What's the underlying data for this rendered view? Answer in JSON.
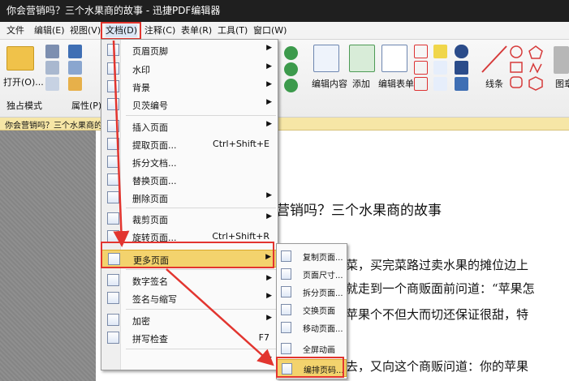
{
  "window": {
    "title": "你会营销吗？三个水果商的故事  - 迅捷PDF编辑器"
  },
  "menubar": {
    "items": [
      "文件",
      "编辑(E)",
      "视图(V)",
      "文档(D)",
      "注释(C)",
      "表单(R)",
      "工具(T)",
      "窗口(W)"
    ]
  },
  "ribbon": {
    "open_label": "打开(O)...",
    "exclusive_mode": "独占模式",
    "properties": "属性(P)...",
    "edit_content": "编辑内容",
    "add": "添加",
    "edit_form": "编辑表单",
    "lines": "线条",
    "shapes": "图章"
  },
  "doc_tab": {
    "title": "你会营销吗？三个水果商的故"
  },
  "document": {
    "heading": "营销吗？三个水果商的故事",
    "line1": "菜，买完菜路过卖水果的摊位边上",
    "line2": "就走到一个商贩面前问道：“苹果怎",
    "line3": "苹果个不但大而切还保证很甜，特",
    "line4": "去，又向这个商贩问道：你的苹果"
  },
  "doc_menu": {
    "items": [
      {
        "label": "页眉页脚",
        "shortcut": "",
        "submenu": true
      },
      {
        "label": "水印",
        "shortcut": "",
        "submenu": true
      },
      {
        "label": "背景",
        "shortcut": "",
        "submenu": true
      },
      {
        "label": "贝茨编号",
        "shortcut": "",
        "submenu": true
      },
      {
        "label": "插入页面",
        "shortcut": "",
        "submenu": true
      },
      {
        "label": "提取页面...",
        "shortcut": "Ctrl+Shift+E",
        "submenu": false
      },
      {
        "label": "拆分文档...",
        "shortcut": "",
        "submenu": false
      },
      {
        "label": "替换页面...",
        "shortcut": "",
        "submenu": false
      },
      {
        "label": "删除页面",
        "shortcut": "",
        "submenu": true
      },
      {
        "label": "裁剪页面",
        "shortcut": "",
        "submenu": true
      },
      {
        "label": "旋转页面...",
        "shortcut": "Ctrl+Shift+R",
        "submenu": false
      },
      {
        "label": "更多页面",
        "shortcut": "",
        "submenu": true
      },
      {
        "label": "数字签名",
        "shortcut": "",
        "submenu": true
      },
      {
        "label": "签名与缩写",
        "shortcut": "",
        "submenu": true
      },
      {
        "label": "加密",
        "shortcut": "",
        "submenu": true
      },
      {
        "label": "拼写检查",
        "shortcut": "F7",
        "submenu": false
      }
    ]
  },
  "sub_menu": {
    "items": [
      "复制页面...",
      "页面尺寸...",
      "拆分页面...",
      "交换页面",
      "移动页面...",
      "全屏动画",
      "编排页码..."
    ]
  },
  "colors": {
    "highlight_red": "#e2352f",
    "menu_hover": "#f3d36d",
    "titlebar": "#1f1f1f"
  }
}
